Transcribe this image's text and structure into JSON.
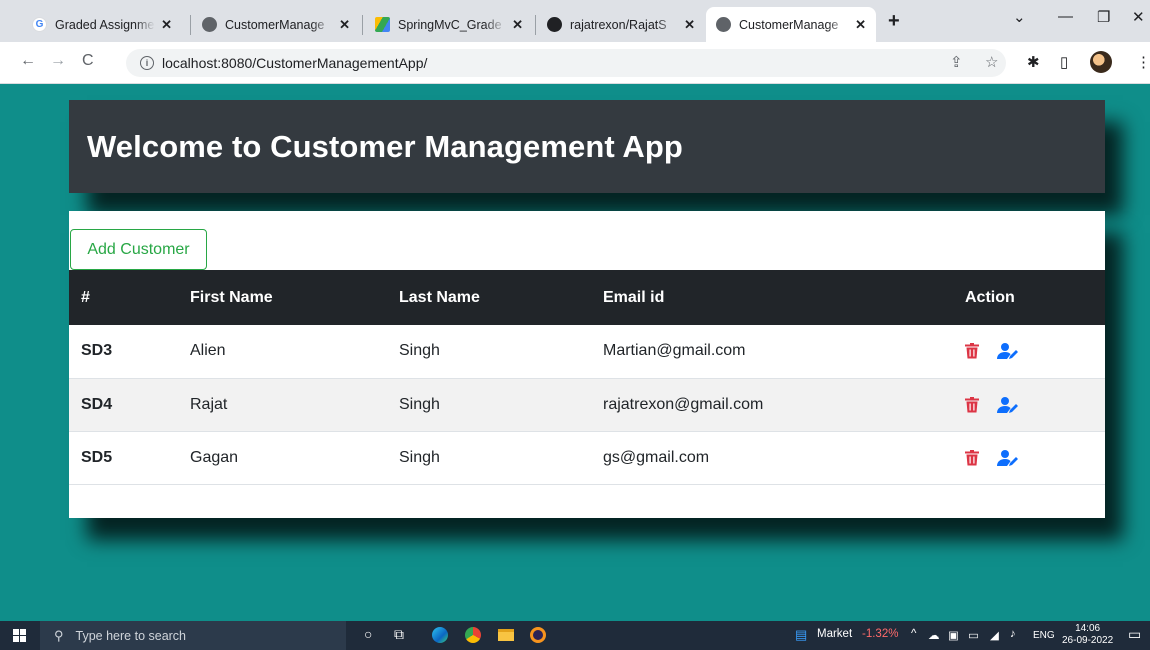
{
  "browser": {
    "tabs": [
      {
        "title": "Graded Assignme",
        "icon": "google-icon",
        "active": false
      },
      {
        "title": "CustomerManage",
        "icon": "globe-icon",
        "active": false
      },
      {
        "title": "SpringMvC_Grade",
        "icon": "drive-icon",
        "active": false
      },
      {
        "title": "rajatrexon/RajatS",
        "icon": "github-icon",
        "active": false
      },
      {
        "title": "CustomerManage",
        "icon": "globe-icon",
        "active": true
      }
    ],
    "close_glyph": "✕",
    "new_tab_glyph": "+",
    "url": "localhost:8080/CustomerManagementApp/"
  },
  "page": {
    "heading": "Welcome to Customer Management App",
    "add_button": "Add Customer",
    "columns": [
      "#",
      "First Name",
      "Last Name",
      "Email id",
      "Action"
    ],
    "rows": [
      {
        "id": "SD3",
        "first": "Alien",
        "last": "Singh",
        "email": "Martian@gmail.com"
      },
      {
        "id": "SD4",
        "first": "Rajat",
        "last": "Singh",
        "email": "rajatrexon@gmail.com"
      },
      {
        "id": "SD5",
        "first": "Gagan",
        "last": "Singh",
        "email": "gs@gmail.com"
      }
    ],
    "colors": {
      "background": "#0f8e8a",
      "header": "#343a40",
      "table_head": "#212529",
      "add_button": "#28a745",
      "delete": "#dc3545",
      "edit": "#0d6efd"
    }
  },
  "taskbar": {
    "search_placeholder": "Type here to search",
    "market_label": "Market",
    "market_change": "-1.32%",
    "language": "ENG",
    "time": "14:06",
    "date": "26-09-2022"
  }
}
